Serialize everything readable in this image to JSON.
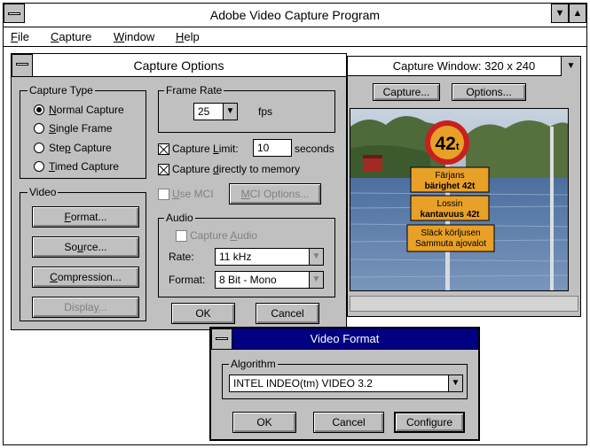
{
  "main_window": {
    "title": "Adobe Video Capture Program",
    "menu": [
      {
        "label": "File",
        "key": "F",
        "rest": "ile"
      },
      {
        "label": "Capture",
        "key": "C",
        "rest": "apture"
      },
      {
        "label": "Window",
        "key": "W",
        "rest": "indow"
      },
      {
        "label": "Help",
        "key": "H",
        "rest": "elp"
      }
    ],
    "controls": {
      "minimize": "▼",
      "maximize": "▲"
    }
  },
  "capture_window": {
    "title": "Capture Window: 320 x 240",
    "buttons": {
      "capture": "Capture...",
      "options": "Options..."
    },
    "sign": {
      "number": "42",
      "sub": "t",
      "plate1": [
        "Färjans",
        "bärighet 42t"
      ],
      "plate2": [
        "Lossin",
        "kantavuus 42t"
      ],
      "plate3": [
        "Släck körljusen",
        "Sammuta ajovalot"
      ]
    }
  },
  "capture_options": {
    "title": "Capture Options",
    "capture_type": {
      "label": "Capture Type",
      "options": [
        {
          "pre": "",
          "key": "N",
          "post": "ormal Capture",
          "selected": true
        },
        {
          "pre": "",
          "key": "S",
          "post": "ingle Frame",
          "selected": false
        },
        {
          "pre": "Ste",
          "key": "p",
          "post": " Capture",
          "selected": false
        },
        {
          "pre": "",
          "key": "T",
          "post": "imed Capture",
          "selected": false
        }
      ]
    },
    "frame_rate": {
      "label": "Frame Rate",
      "value": "25",
      "unit": "fps"
    },
    "capture_limit": {
      "pre": "Capture ",
      "key": "L",
      "post": "imit:",
      "checked": true,
      "value": "10",
      "unit": "seconds"
    },
    "capture_memory": {
      "pre": "Capture ",
      "key": "d",
      "post": "irectly to memory",
      "checked": true
    },
    "video": {
      "label": "Video",
      "buttons": [
        {
          "pre": "",
          "key": "F",
          "post": "ormat...",
          "enabled": true
        },
        {
          "pre": "So",
          "key": "u",
          "post": "rce...",
          "enabled": true
        },
        {
          "pre": "",
          "key": "C",
          "post": "ompression...",
          "enabled": true
        },
        {
          "pre": "Displa",
          "key": "y",
          "post": "...",
          "enabled": false
        }
      ]
    },
    "use_mci": {
      "pre": "",
      "key": "U",
      "post": "se MCI",
      "checked": false,
      "enabled": false
    },
    "mci_options": {
      "pre": "",
      "key": "M",
      "post": "CI Options...",
      "enabled": false
    },
    "audio": {
      "label": "Audio",
      "capture_audio": {
        "pre": "Capture ",
        "key": "A",
        "post": "udio",
        "checked": false,
        "enabled": false
      },
      "rate_label": "Rate:",
      "rate_value": "11 kHz",
      "format_label": "Format:",
      "format_value": "8 Bit - Mono"
    },
    "ok": "OK",
    "cancel": "Cancel"
  },
  "video_format": {
    "title": "Video Format",
    "algorithm_label": "Algorithm",
    "algorithm_value": "INTEL INDEO(tm) VIDEO 3.2",
    "ok": "OK",
    "cancel": "Cancel",
    "configure": "Configure"
  },
  "colors": {
    "dialog_face": "#c0c0c0",
    "active_title": "#000080",
    "sign_orange": "#e8a028",
    "sign_red": "#c8201e"
  }
}
